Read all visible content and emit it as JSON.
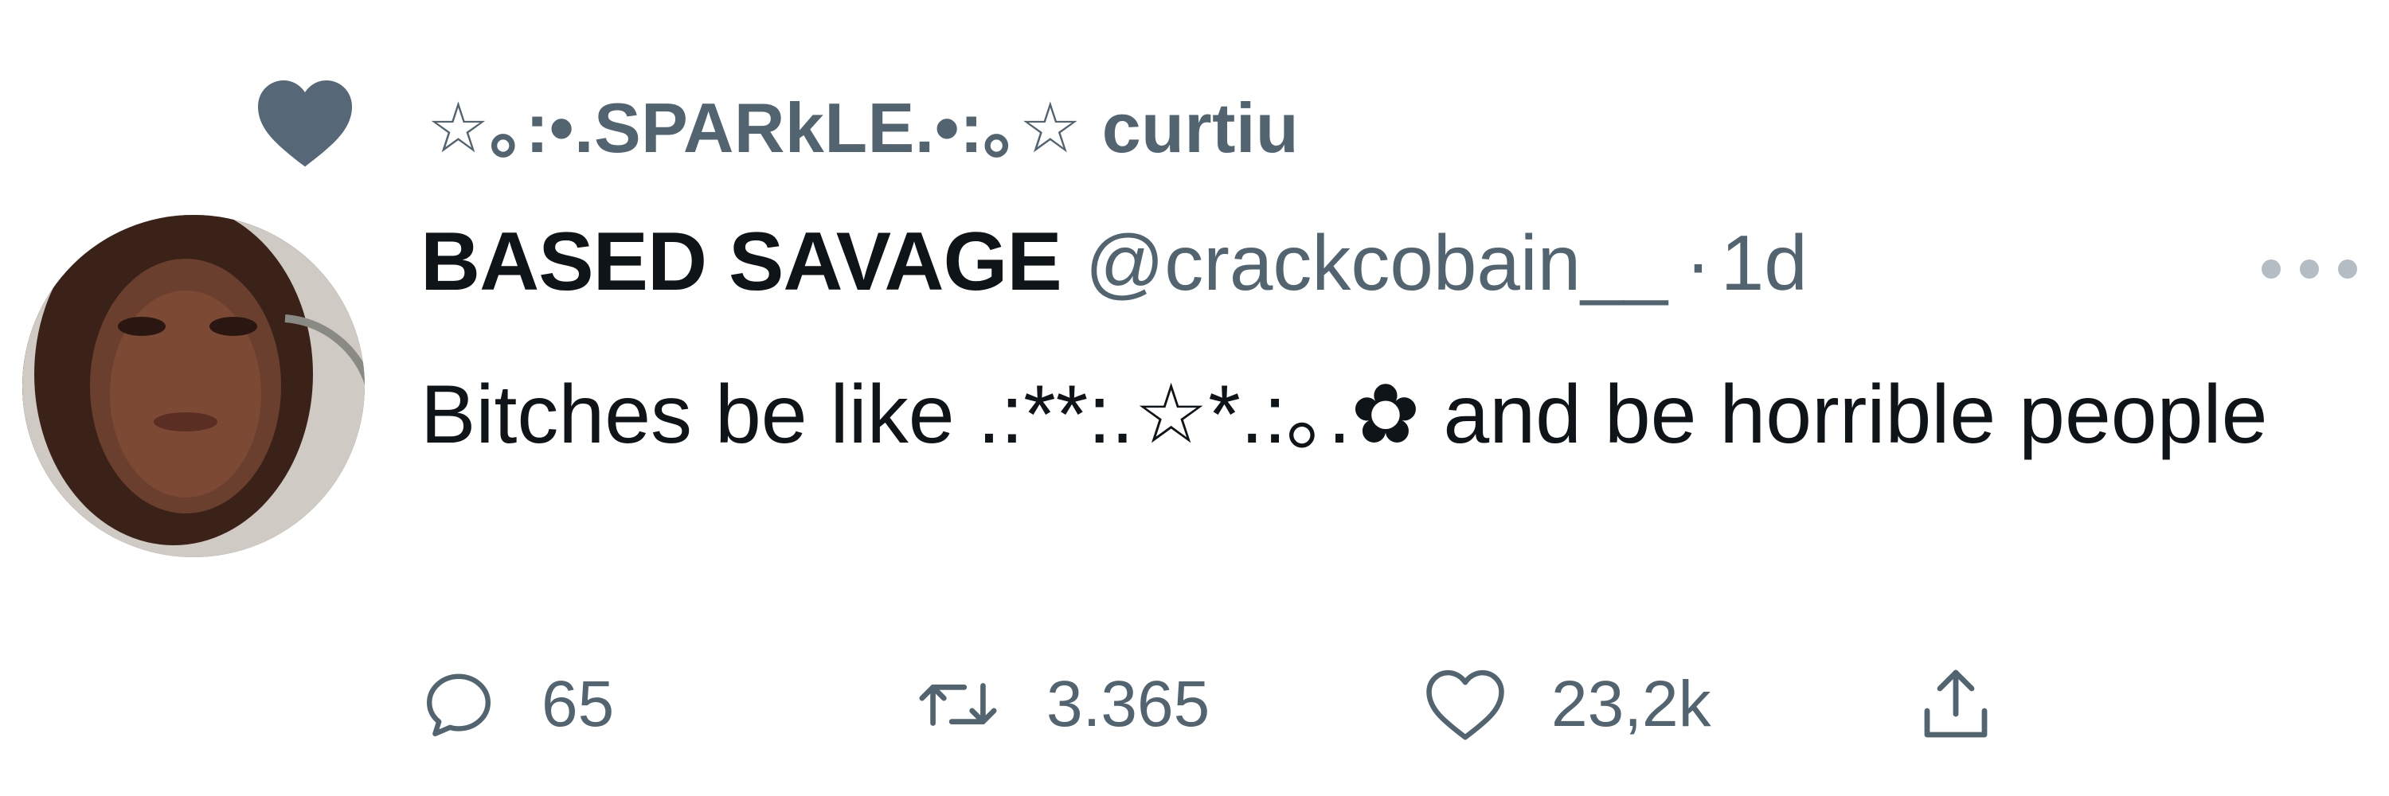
{
  "social_context": {
    "icon": "heart-filled-icon",
    "text": "☆｡:•.SPARkLE.•:｡☆ curtiu"
  },
  "author": {
    "display_name": "BASED SAVAGE",
    "handle": "@crackcobain__",
    "separator": "·",
    "time": "1d"
  },
  "tweet": {
    "text": "Bitches be like .:**:.☆*.:｡.✿ and be horrible people"
  },
  "actions": {
    "reply_count": "65",
    "retweet_count": "3.365",
    "like_count": "23,2k"
  },
  "colors": {
    "text_primary": "#0f1419",
    "text_secondary": "#536471",
    "heart_fill": "#566878"
  }
}
